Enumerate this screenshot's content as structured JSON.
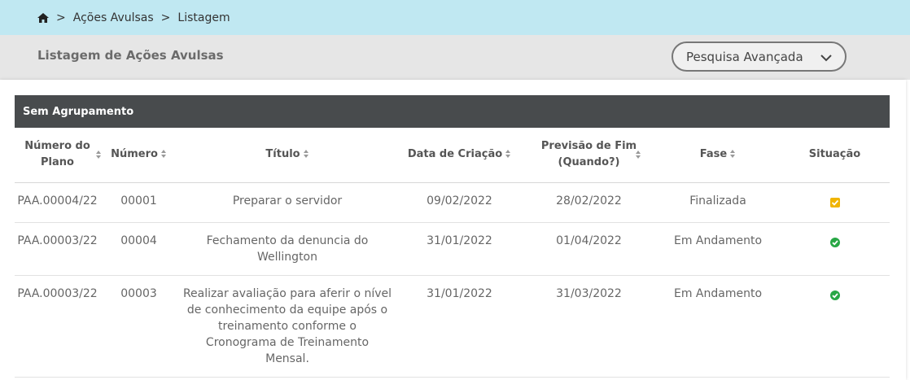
{
  "breadcrumb": {
    "home_icon": "home-icon",
    "sep1": ">",
    "item1": "Ações Avulsas",
    "sep2": ">",
    "item2": "Listagem"
  },
  "header": {
    "title": "Listagem de Ações Avulsas",
    "advanced_search_label": "Pesquisa Avançada"
  },
  "group": {
    "label": "Sem Agrupamento"
  },
  "table": {
    "columns": {
      "plan_number_line1": "Número do",
      "plan_number_line2": "Plano",
      "number": "Número",
      "title": "Título",
      "created": "Data de Criação",
      "forecast_line1": "Previsão de Fim",
      "forecast_line2": "(Quando?)",
      "phase": "Fase",
      "status": "Situação"
    },
    "rows": [
      {
        "plan": "PAA.00004/22",
        "number": "00001",
        "title_lines": [
          "Preparar o servidor"
        ],
        "created": "09/02/2022",
        "forecast": "28/02/2022",
        "phase": "Finalizada",
        "status_icon": "checkbox-checked-icon",
        "status_color": "#f0b400"
      },
      {
        "plan": "PAA.00003/22",
        "number": "00004",
        "title_lines": [
          "Fechamento da denuncia do",
          "Wellington"
        ],
        "created": "31/01/2022",
        "forecast": "01/04/2022",
        "phase": "Em Andamento",
        "status_icon": "check-circle-icon",
        "status_color": "#28a745"
      },
      {
        "plan": "PAA.00003/22",
        "number": "00003",
        "title_lines": [
          "Realizar avaliação para aferir o nível",
          "de conhecimento da equipe após o",
          "treinamento conforme o",
          "Cronograma de Treinamento",
          "Mensal."
        ],
        "created": "31/01/2022",
        "forecast": "31/03/2022",
        "phase": "Em Andamento",
        "status_icon": "check-circle-icon",
        "status_color": "#28a745"
      }
    ]
  },
  "colors": {
    "breadcrumb_bg": "#c0e8f2",
    "header_bg": "#e6e6e6",
    "group_header_bg": "#484b4d"
  }
}
